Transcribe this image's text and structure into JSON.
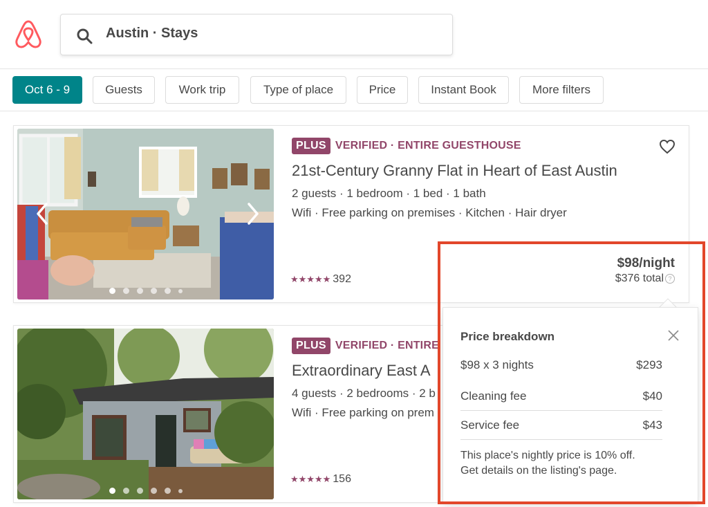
{
  "search": {
    "text": "Austin · Stays"
  },
  "filters": [
    "Oct 6 - 9",
    "Guests",
    "Work trip",
    "Type of place",
    "Price",
    "Instant Book",
    "More filters"
  ],
  "listings": [
    {
      "badge": "PLUS",
      "type": "VERIFIED · ENTIRE GUESTHOUSE",
      "title": "21st-Century Granny Flat in Heart of East Austin",
      "details": "2 guests · 1 bedroom · 1 bed · 1 bath",
      "amenities": "Wifi · Free parking on premises · Kitchen · Hair dryer",
      "stars": "★★★★★",
      "reviews": "392"
    },
    {
      "badge": "PLUS",
      "type": "VERIFIED · ENTIRE H",
      "title": "Extraordinary East A",
      "details": "4 guests · 2 bedrooms · 2 b",
      "amenities": "Wifi · Free parking on prem",
      "stars": "★★★★★",
      "reviews": "156"
    }
  ],
  "price": {
    "per_night": "$98/night",
    "total": "$376 total",
    "help": "?"
  },
  "breakdown": {
    "title": "Price breakdown",
    "rows": [
      {
        "label": "$98 x 3 nights",
        "amount": "$293"
      },
      {
        "label": "Cleaning fee",
        "amount": "$40"
      },
      {
        "label": "Service fee",
        "amount": "$43"
      }
    ],
    "note_line1": "This place's nightly price is 10% off.",
    "note_line2": "Get details on the listing's page."
  },
  "colors": {
    "brand": "#ff5a5f",
    "accent": "#008489",
    "plus": "#914669",
    "highlight": "#e2472b"
  }
}
